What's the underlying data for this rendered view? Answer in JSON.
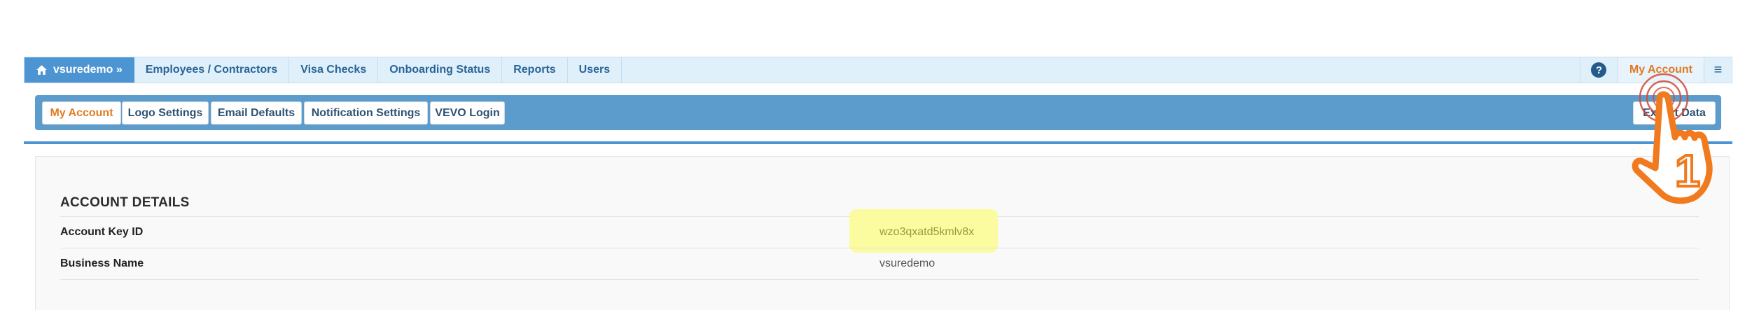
{
  "topnav": {
    "brand_label": "vsuredemo »",
    "items": [
      {
        "label": "Employees / Contractors"
      },
      {
        "label": "Visa Checks"
      },
      {
        "label": "Onboarding Status"
      },
      {
        "label": "Reports"
      },
      {
        "label": "Users"
      }
    ],
    "help_label": "?",
    "my_account_label": "My Account",
    "menu_label": "≡"
  },
  "subnav": {
    "tabs": [
      {
        "label": "My Account"
      },
      {
        "label": "Logo Settings"
      },
      {
        "label": "Email Defaults"
      },
      {
        "label": "Notification Settings"
      },
      {
        "label": "VEVO Login"
      }
    ],
    "right_button_label": "Export Data"
  },
  "account": {
    "section_title": "ACCOUNT DETAILS",
    "rows": [
      {
        "label": "Account Key ID",
        "value": "wzo3qxatd5kmlv8x"
      },
      {
        "label": "Business Name",
        "value": "vsuredemo"
      }
    ]
  },
  "annotation": {
    "step_number": "1"
  },
  "colors": {
    "brand": "#4c94d2",
    "accent": "#e07b23",
    "subnav_bg": "#5b9ccd",
    "highlight": "#fbfb9a",
    "pointer": "#f07a1d"
  }
}
